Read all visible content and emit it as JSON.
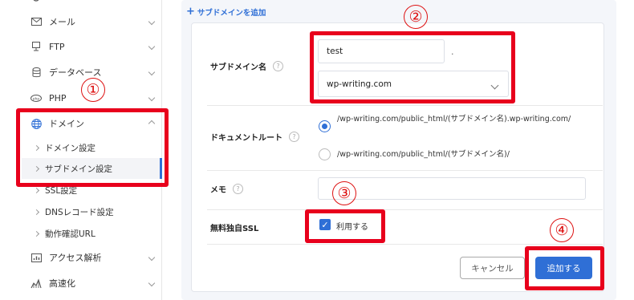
{
  "sidebar": {
    "items": [
      {
        "label": "メール",
        "icon": "mail-icon"
      },
      {
        "label": "FTP",
        "icon": "monitor-icon"
      },
      {
        "label": "データベース",
        "icon": "database-icon"
      },
      {
        "label": "PHP",
        "icon": "php-icon"
      },
      {
        "label": "ドメイン",
        "icon": "globe-icon"
      },
      {
        "label": "アクセス解析",
        "icon": "chart-icon"
      },
      {
        "label": "高速化",
        "icon": "speed-icon"
      }
    ],
    "domain_sub": [
      {
        "label": "ドメイン設定"
      },
      {
        "label": "サブドメイン設定"
      },
      {
        "label": "SSL設定"
      },
      {
        "label": "DNSレコード設定"
      },
      {
        "label": "動作確認URL"
      }
    ]
  },
  "main": {
    "add_link": "サブドメインを追加",
    "subdomain_label": "サブドメイン名",
    "subdomain_value": "test",
    "dot": ".",
    "domain_select": "wp-writing.com",
    "docroot_label": "ドキュメントルート",
    "docroot_option1": "/wp-writing.com/public_html/(サブドメイン名).wp-writing.com/",
    "docroot_option2": "/wp-writing.com/public_html/(サブドメイン名)/",
    "memo_label": "メモ",
    "ssl_label": "無料独自SSL",
    "ssl_checkbox": "利用する",
    "help_glyph": "?",
    "cancel_button": "キャンセル",
    "add_button": "追加する"
  },
  "annotations": {
    "n1": "①",
    "n2": "②",
    "n3": "③",
    "n4": "④"
  },
  "colors": {
    "accent": "#2f6fd6",
    "highlight": "#e8001c"
  }
}
